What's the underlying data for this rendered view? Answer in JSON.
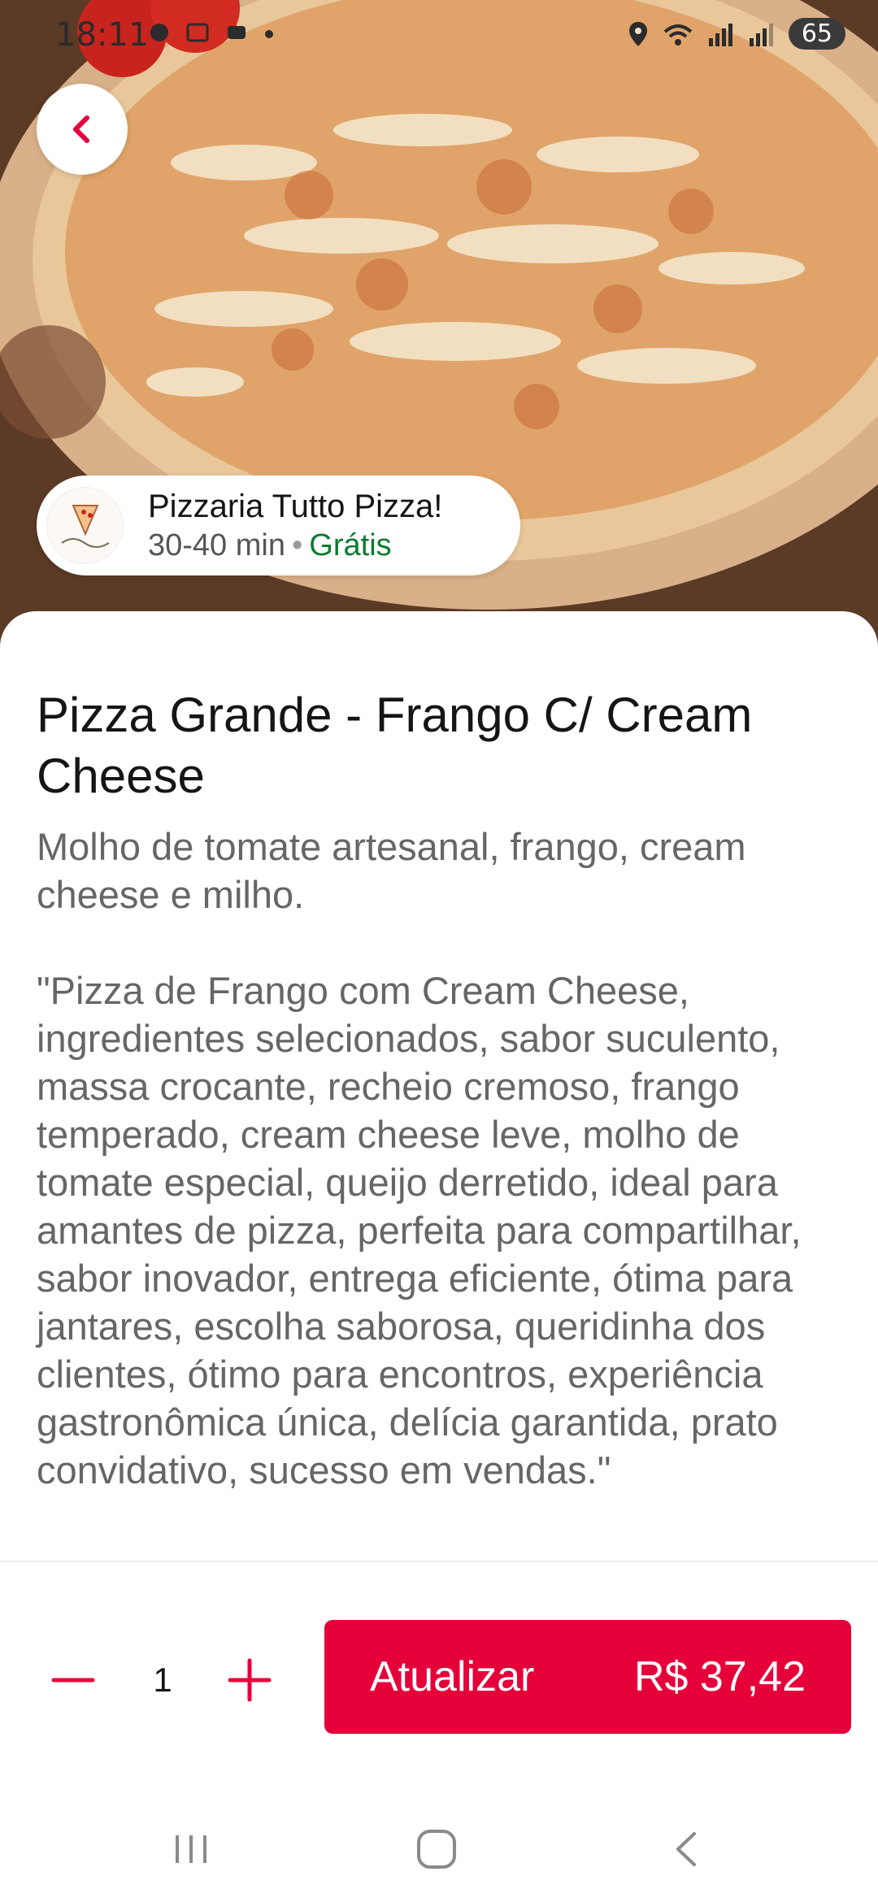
{
  "status_bar": {
    "time": "18:11",
    "battery": "65",
    "icons": [
      "whatsapp-icon",
      "screenshot-icon",
      "app-icon",
      "dot-icon",
      "location-icon",
      "wifi-icon",
      "signal-icon",
      "signal-icon",
      "battery-icon"
    ]
  },
  "restaurant": {
    "name": "Pizzaria Tutto Pizza!",
    "delivery_time": "30-40 min",
    "separator": "•",
    "delivery_fee": "Grátis"
  },
  "product": {
    "title": "Pizza Grande - Frango C/ Cream Cheese",
    "description": "Molho de tomate artesanal, frango, cream cheese e milho.\n\n\"Pizza de Frango com Cream Cheese, ingredientes selecionados, sabor suculento, massa crocante, recheio cremoso, frango temperado, cream cheese leve, molho de tomate especial, queijo derretido, ideal para amantes de pizza, perfeita para compartilhar, sabor inovador, entrega eficiente, ótima para jantares, escolha saborosa, queridinha dos clientes, ótimo para encontros, experiência gastronômica única, delícia garantida, prato convidativo, sucesso em vendas.\""
  },
  "cart": {
    "quantity": "1",
    "update_label": "Atualizar",
    "price": "R$ 37,42"
  },
  "colors": {
    "accent": "#e5003a",
    "free_green": "#0c7a2f",
    "title_text": "#151515",
    "body_text": "#666666"
  }
}
